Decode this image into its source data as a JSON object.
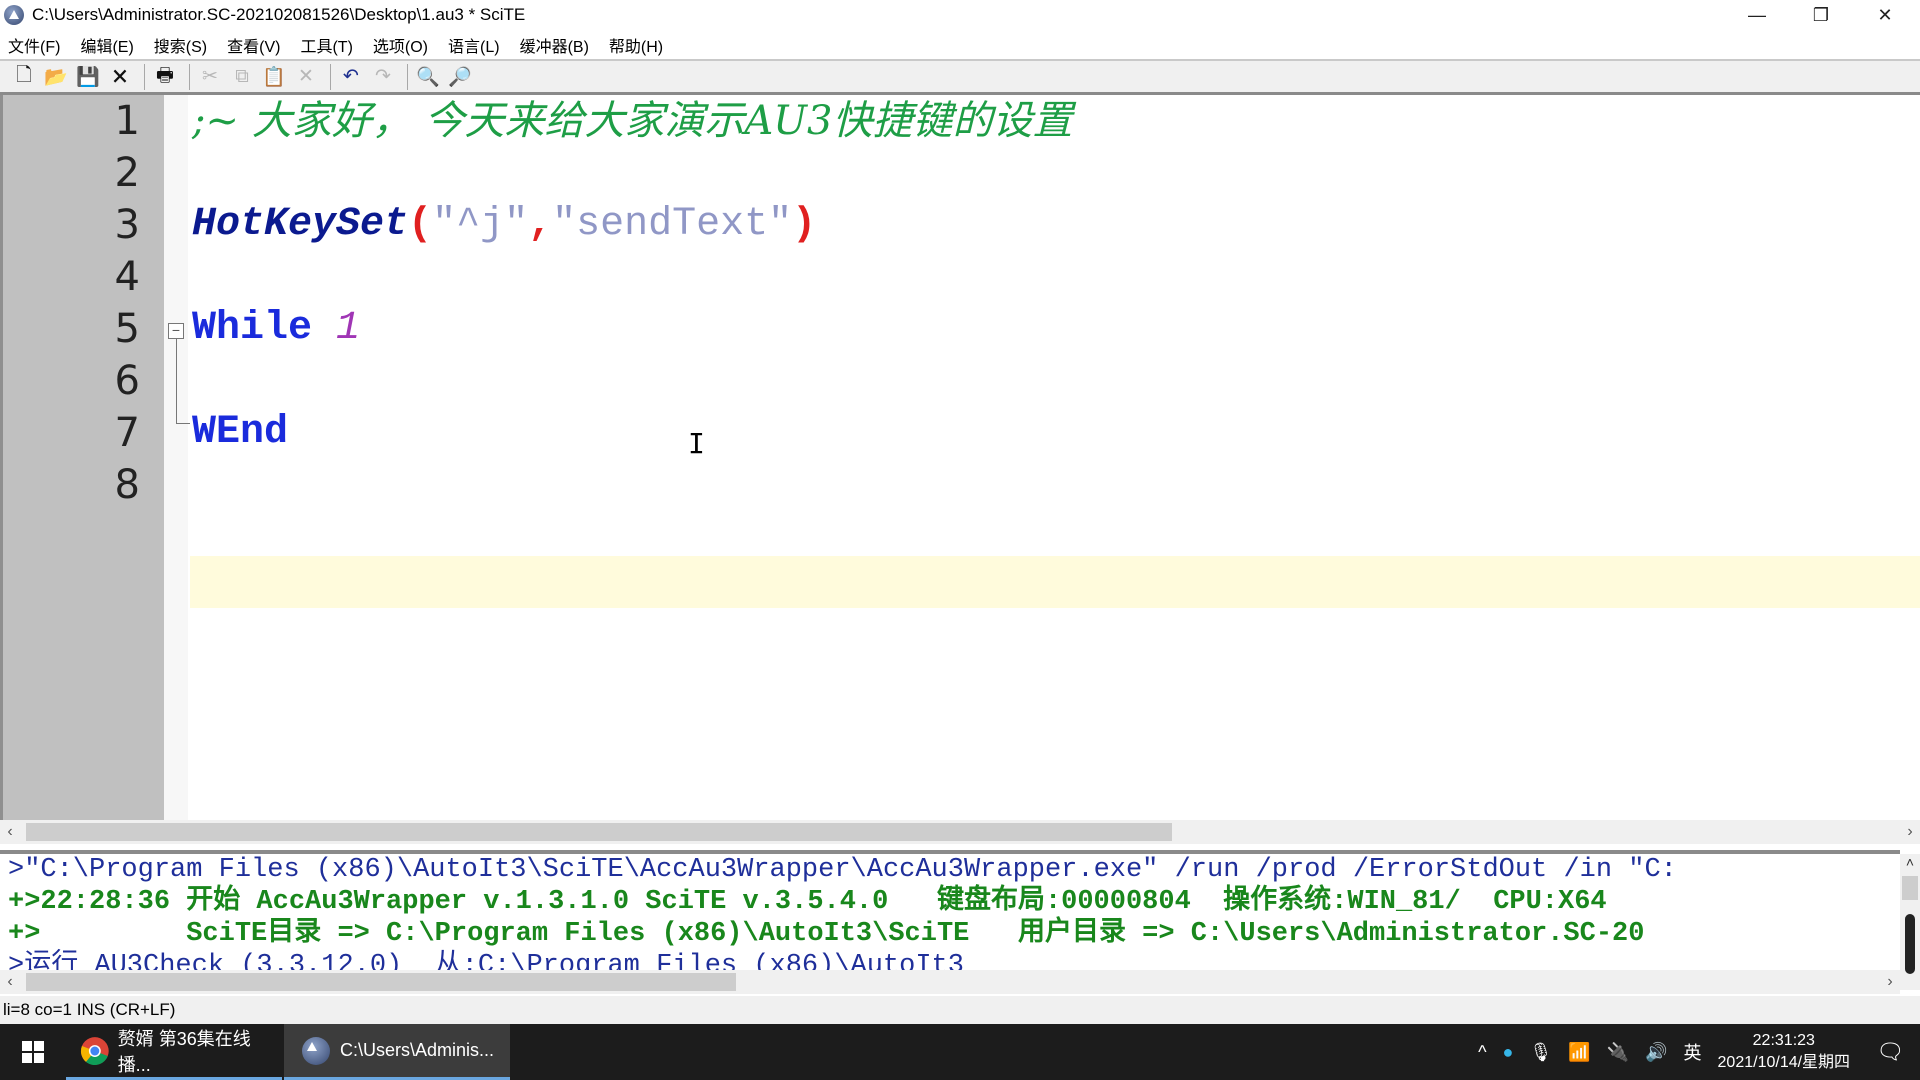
{
  "window": {
    "title": "C:\\Users\\Administrator.SC-202102081526\\Desktop\\1.au3 * SciTE",
    "minimize": "—",
    "restore": "❐",
    "close": "✕"
  },
  "menu": [
    "文件(F)",
    "编辑(E)",
    "搜索(S)",
    "查看(V)",
    "工具(T)",
    "选项(O)",
    "语言(L)",
    "缓冲器(B)",
    "帮助(H)"
  ],
  "toolbar": {
    "icons": [
      {
        "name": "new-file-icon",
        "glyph": "🗋",
        "disabled": false
      },
      {
        "name": "open-folder-icon",
        "glyph": "📂",
        "disabled": false
      },
      {
        "name": "save-icon",
        "glyph": "💾",
        "disabled": false
      },
      {
        "name": "close-file-icon",
        "glyph": "🗙",
        "disabled": false
      },
      {
        "name": "print-icon",
        "glyph": "🖶",
        "disabled": false
      },
      {
        "name": "cut-icon",
        "glyph": "✂",
        "disabled": true
      },
      {
        "name": "copy-icon",
        "glyph": "⧉",
        "disabled": true
      },
      {
        "name": "paste-icon",
        "glyph": "📋",
        "disabled": false
      },
      {
        "name": "delete-icon",
        "glyph": "✕",
        "disabled": true
      },
      {
        "name": "undo-icon",
        "glyph": "↶",
        "disabled": false
      },
      {
        "name": "redo-icon",
        "glyph": "↷",
        "disabled": true
      },
      {
        "name": "find-icon",
        "glyph": "🔍",
        "disabled": false
      },
      {
        "name": "replace-icon",
        "glyph": "🔎",
        "disabled": false
      }
    ]
  },
  "editor": {
    "line_numbers": [
      "1",
      "2",
      "3",
      "4",
      "5",
      "6",
      "7",
      "8"
    ],
    "line1_comment": ";~ 大家好， 今天来给大家演示AU3快捷键的设置",
    "line3": {
      "func": "HotKeySet",
      "open": "(",
      "arg1": "\"^j\"",
      "comma": ",",
      "arg2": "\"sendText\"",
      "close": ")"
    },
    "line5": {
      "keyword": "While",
      "space": " ",
      "value": "1"
    },
    "line7": {
      "keyword": "WEnd"
    },
    "fold_marker": "−",
    "cursor": "I"
  },
  "console": {
    "lines": [
      ">\"C:\\Program Files (x86)\\AutoIt3\\SciTE\\AccAu3Wrapper\\AccAu3Wrapper.exe\" /run /prod /ErrorStdOut /in \"C:",
      "+>22:28:36 开始 AccAu3Wrapper v.1.3.1.0 SciTE v.3.5.4.0   键盘布局:00000804  操作系统:WIN_81/  CPU:X64",
      "+>         SciTE目录 => C:\\Program Files (x86)\\AutoIt3\\SciTE   用户目录 => C:\\Users\\Administrator.SC-20",
      ">运行 AU3Check (3.3.12.0)  从:C:\\Program Files (x86)\\AutoIt3"
    ]
  },
  "scroll": {
    "left": "‹",
    "right": "›",
    "up": "˄",
    "down": "˅"
  },
  "status": "li=8 co=1 INS (CR+LF)",
  "taskbar": {
    "tasks": [
      {
        "label": "赘婿 第36集在线播..."
      },
      {
        "label": "C:\\Users\\Adminis..."
      }
    ],
    "tray": {
      "chevron": "^",
      "ime": "英",
      "time": "22:31:23",
      "date": "2021/10/14/星期四"
    }
  }
}
